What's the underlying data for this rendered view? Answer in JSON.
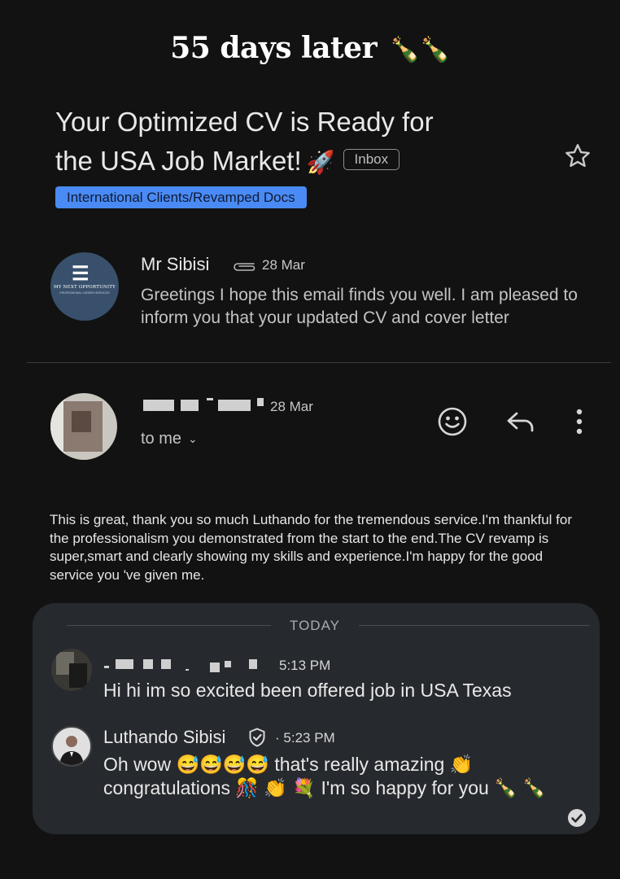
{
  "headline": {
    "text": "55 days later",
    "emoji": "🍾🍾"
  },
  "email": {
    "subject_line1": "Your Optimized CV is Ready for",
    "subject_line2": "the USA Job Market!",
    "subject_emoji": "🚀",
    "inbox_badge": "Inbox",
    "label_chip": "International Clients/Revamped Docs",
    "label_color": "#4a8af4"
  },
  "message1": {
    "sender": "Mr Sibisi",
    "date": "28 Mar",
    "snippet": "Greetings I hope this email finds you well. I am pleased to inform you that your updated CV and cover letter",
    "avatar_logo_text": "MY NEXT OPPORTUNITY",
    "avatar_logo_subtext": "PROFESSIONAL CAREER SERVICES"
  },
  "message2": {
    "date": "28 Mar",
    "recipient": "to me",
    "body": "This is great, thank you so much Luthando for the tremendous service.I'm thankful for the professionalism you demonstrated from the start to the end.The CV revamp is super,smart and clearly showing my skills and experience.I'm happy for the good service you 've given me."
  },
  "chat": {
    "day_separator": "TODAY",
    "messages": [
      {
        "time": "5:13 PM",
        "text": "Hi hi im so excited been offered job in USA Texas"
      },
      {
        "sender": "Luthando Sibisi",
        "separator": "·",
        "time": "5:23 PM",
        "text": "Oh wow 😅😅😅😅 that's really amazing 👏 congratulations 🎊 👏 💐 I'm so happy for you 🍾 🍾"
      }
    ]
  },
  "icons": [
    "star-icon",
    "attachment-icon",
    "emoji-reaction-icon",
    "reply-icon",
    "more-options-icon",
    "chevron-down-icon",
    "verified-badge-icon",
    "read-receipt-icon"
  ]
}
